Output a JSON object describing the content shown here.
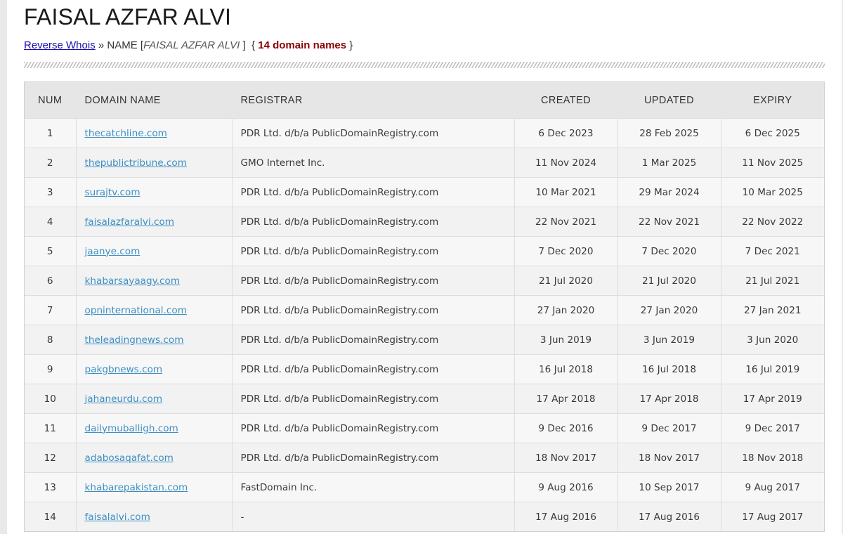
{
  "page": {
    "title": "FAISAL AZFAR ALVI",
    "breadcrumb": {
      "link": "Reverse Whois",
      "separator": "»",
      "name_label": "NAME",
      "name_value": "FAISAL AZFAR ALVI",
      "count_text": "14 domain names"
    }
  },
  "table": {
    "headers": [
      "NUM",
      "DOMAIN NAME",
      "REGISTRAR",
      "CREATED",
      "UPDATED",
      "EXPIRY"
    ],
    "rows": [
      {
        "num": "1",
        "domain": "thecatchline.com",
        "registrar": "PDR Ltd. d/b/a PublicDomainRegistry.com",
        "created": "6 Dec 2023",
        "updated": "28 Feb 2025",
        "expiry": "6 Dec 2025"
      },
      {
        "num": "2",
        "domain": "thepublictribune.com",
        "registrar": "GMO Internet Inc.",
        "created": "11 Nov 2024",
        "updated": "1 Mar 2025",
        "expiry": "11 Nov 2025"
      },
      {
        "num": "3",
        "domain": "surajtv.com",
        "registrar": "PDR Ltd. d/b/a PublicDomainRegistry.com",
        "created": "10 Mar 2021",
        "updated": "29 Mar 2024",
        "expiry": "10 Mar 2025"
      },
      {
        "num": "4",
        "domain": "faisalazfaralvi.com",
        "registrar": "PDR Ltd. d/b/a PublicDomainRegistry.com",
        "created": "22 Nov 2021",
        "updated": "22 Nov 2021",
        "expiry": "22 Nov 2022"
      },
      {
        "num": "5",
        "domain": "jaanye.com",
        "registrar": "PDR Ltd. d/b/a PublicDomainRegistry.com",
        "created": "7 Dec 2020",
        "updated": "7 Dec 2020",
        "expiry": "7 Dec 2021"
      },
      {
        "num": "6",
        "domain": "khabarsayaagy.com",
        "registrar": "PDR Ltd. d/b/a PublicDomainRegistry.com",
        "created": "21 Jul 2020",
        "updated": "21 Jul 2020",
        "expiry": "21 Jul 2021"
      },
      {
        "num": "7",
        "domain": "opninternational.com",
        "registrar": "PDR Ltd. d/b/a PublicDomainRegistry.com",
        "created": "27 Jan 2020",
        "updated": "27 Jan 2020",
        "expiry": "27 Jan 2021"
      },
      {
        "num": "8",
        "domain": "theleadingnews.com",
        "registrar": "PDR Ltd. d/b/a PublicDomainRegistry.com",
        "created": "3 Jun 2019",
        "updated": "3 Jun 2019",
        "expiry": "3 Jun 2020"
      },
      {
        "num": "9",
        "domain": "pakgbnews.com",
        "registrar": "PDR Ltd. d/b/a PublicDomainRegistry.com",
        "created": "16 Jul 2018",
        "updated": "16 Jul 2018",
        "expiry": "16 Jul 2019"
      },
      {
        "num": "10",
        "domain": "jahaneurdu.com",
        "registrar": "PDR Ltd. d/b/a PublicDomainRegistry.com",
        "created": "17 Apr 2018",
        "updated": "17 Apr 2018",
        "expiry": "17 Apr 2019"
      },
      {
        "num": "11",
        "domain": "dailymuballigh.com",
        "registrar": "PDR Ltd. d/b/a PublicDomainRegistry.com",
        "created": "9 Dec 2016",
        "updated": "9 Dec 2017",
        "expiry": "9 Dec 2017"
      },
      {
        "num": "12",
        "domain": "adabosaqafat.com",
        "registrar": "PDR Ltd. d/b/a PublicDomainRegistry.com",
        "created": "18 Nov 2017",
        "updated": "18 Nov 2017",
        "expiry": "18 Nov 2018"
      },
      {
        "num": "13",
        "domain": "khabarepakistan.com",
        "registrar": "FastDomain Inc.",
        "created": "9 Aug 2016",
        "updated": "10 Sep 2017",
        "expiry": "9 Aug 2017"
      },
      {
        "num": "14",
        "domain": "faisalalvi.com",
        "registrar": "-",
        "created": "17 Aug 2016",
        "updated": "17 Aug 2016",
        "expiry": "17 Aug 2017"
      }
    ]
  },
  "colors": {
    "link": "#1a0dab",
    "domain_link": "#3d8fc4",
    "count": "#8b0000",
    "header_bg": "#e6e6e6"
  }
}
